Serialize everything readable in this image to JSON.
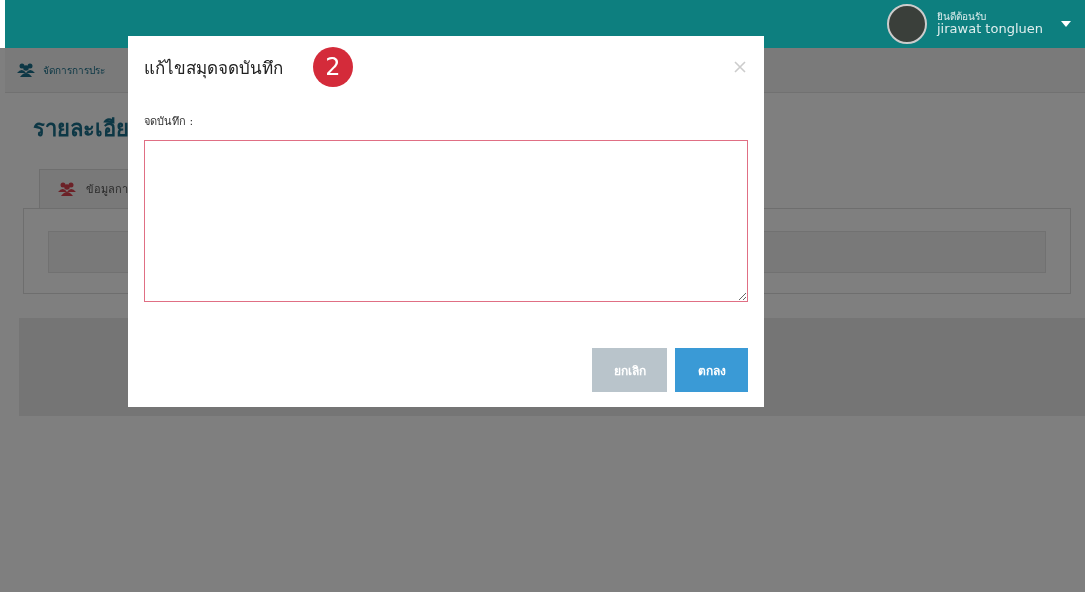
{
  "header": {
    "welcome": "ยินดีต้อนรับ",
    "user_name": "jirawat tongluen"
  },
  "breadcrumb": {
    "label": "จัดการการประ"
  },
  "page_title": "รายละเอีย",
  "tabs": [
    {
      "label": "ข้อมูลกา"
    }
  ],
  "modal": {
    "title": "แก้ไขสมุดจดบันทึก",
    "step_badge": "2",
    "field_label": "จดบันทึก :",
    "buttons": [
      {
        "label": "ยกเลิก",
        "kind": "cancel"
      },
      {
        "label": "ตกลง",
        "kind": "confirm"
      }
    ]
  }
}
